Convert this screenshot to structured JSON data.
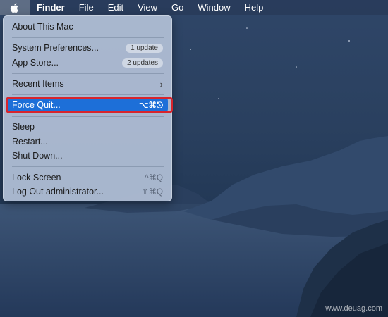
{
  "menubar": {
    "apple_icon": "apple-logo-icon",
    "items": [
      "Finder",
      "File",
      "Edit",
      "View",
      "Go",
      "Window",
      "Help"
    ]
  },
  "apple_menu": {
    "about": "About This Mac",
    "system_prefs": "System Preferences...",
    "system_prefs_badge": "1 update",
    "app_store": "App Store...",
    "app_store_badge": "2 updates",
    "recent_items": "Recent Items",
    "recent_items_icon": "chevron-right-icon",
    "force_quit": "Force Quit...",
    "force_quit_shortcut": "⌥⌘⎋",
    "sleep": "Sleep",
    "restart": "Restart...",
    "shut_down": "Shut Down...",
    "lock_screen": "Lock Screen",
    "lock_screen_shortcut": "^⌘Q",
    "log_out": "Log Out administrator...",
    "log_out_shortcut": "⇧⌘Q"
  },
  "colors": {
    "highlight": "#1d6fd8",
    "annotation_red": "#d8242c"
  },
  "watermark": "www.deuag.com"
}
